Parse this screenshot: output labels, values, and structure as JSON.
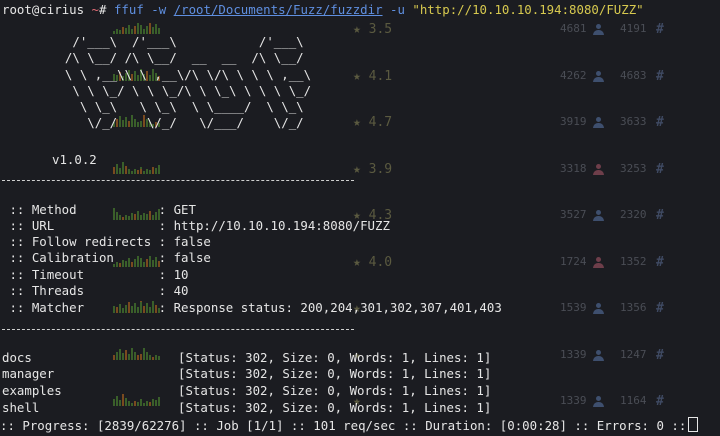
{
  "prompt": {
    "user": "root",
    "at": "@",
    "host": "cirius",
    "path": "~",
    "symbol": "#",
    "command": "ffuf",
    "flag_w": "-w",
    "wordlist": "/root/Documents/Fuzz/fuzzdir",
    "flag_u": "-u",
    "url": "\"http://10.10.10.194:8080/FUZZ\""
  },
  "banner": {
    "art": "   /'___\\  /'___\\           /'___\\\n  /\\ \\__/ /\\ \\__/  __  __  /\\ \\__/\n  \\ \\ ,__\\\\ \\ ,__\\/\\ \\/\\ \\ \\ \\ ,__\\\n   \\ \\ \\_/ \\ \\ \\_/\\ \\ \\_\\ \\ \\ \\ \\_/\n    \\ \\_\\   \\ \\_\\  \\ \\____/  \\ \\_\\\n     \\/_/    \\/_/   \\/___/    \\/_/",
    "version": "v1.0.2"
  },
  "config": [
    {
      "key": " :: Method           ",
      "value": ": GET"
    },
    {
      "key": " :: URL              ",
      "value": ": http://10.10.10.194:8080/FUZZ"
    },
    {
      "key": " :: Follow redirects ",
      "value": ": false"
    },
    {
      "key": " :: Calibration      ",
      "value": ": false"
    },
    {
      "key": " :: Timeout          ",
      "value": ": 10"
    },
    {
      "key": " :: Threads          ",
      "value": ": 40"
    },
    {
      "key": " :: Matcher          ",
      "value": ": Response status: 200,204,301,302,307,401,403"
    }
  ],
  "results": [
    {
      "path": "docs",
      "info": "[Status: 302, Size: 0, Words: 1, Lines: 1]"
    },
    {
      "path": "manager",
      "info": "[Status: 302, Size: 0, Words: 1, Lines: 1]"
    },
    {
      "path": "examples",
      "info": "[Status: 302, Size: 0, Words: 1, Lines: 1]"
    },
    {
      "path": "shell",
      "info": "[Status: 302, Size: 0, Words: 1, Lines: 1]"
    }
  ],
  "status_line": ":: Progress: [2839/62276] :: Job [1/1] :: 101 req/sec :: Duration: [0:00:28] :: Errors: 0 ::",
  "ghost_rows": [
    {
      "rating": "3.5",
      "n1": "4681",
      "n2": "4191",
      "user_color": "#3e4f6e"
    },
    {
      "rating": "4.1",
      "n1": "4262",
      "n2": "4683",
      "user_color": "#3e4f6e"
    },
    {
      "rating": "4.7",
      "n1": "3919",
      "n2": "3633",
      "user_color": "#3e4f6e"
    },
    {
      "rating": "3.9",
      "n1": "3318",
      "n2": "3253",
      "user_color": "#6e3e4a"
    },
    {
      "rating": "4.3",
      "n1": "3527",
      "n2": "2320",
      "user_color": "#3e4f6e"
    },
    {
      "rating": "4.0",
      "n1": "1724",
      "n2": "1352",
      "user_color": "#6e3e4a"
    },
    {
      "rating": "",
      "n1": "1539",
      "n2": "1356",
      "user_color": "#3e4f6e"
    },
    {
      "rating": "",
      "n1": "1339",
      "n2": "1247",
      "user_color": "#3e4f6e"
    },
    {
      "rating": "",
      "n1": "1339",
      "n2": "1164",
      "user_color": "#3e4f6e"
    }
  ]
}
